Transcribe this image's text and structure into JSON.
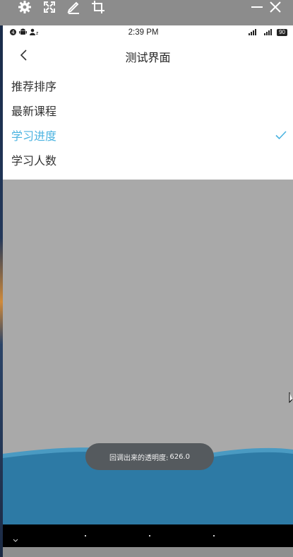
{
  "status_bar": {
    "time": "2:39 PM",
    "battery": "90"
  },
  "nav": {
    "title": "测试界面"
  },
  "menu": {
    "items": [
      {
        "label": "推荐排序",
        "selected": false
      },
      {
        "label": "最新课程",
        "selected": false
      },
      {
        "label": "学习进度",
        "selected": true
      },
      {
        "label": "学习人数",
        "selected": false
      }
    ]
  },
  "toast": {
    "label": "回调出来的透明度:",
    "value": "626.0"
  },
  "colors": {
    "accent": "#4ab3e0",
    "overlay": "#a9a9a9",
    "wave": "#2d7aa5",
    "toast_bg": "#555a5e"
  },
  "icons": {
    "toolbar": [
      "gear-icon",
      "expand-icon",
      "pen-icon",
      "crop-icon",
      "minimize-icon",
      "close-icon"
    ],
    "nav_back": "chevron-left-icon",
    "selected_mark": "check-icon"
  }
}
